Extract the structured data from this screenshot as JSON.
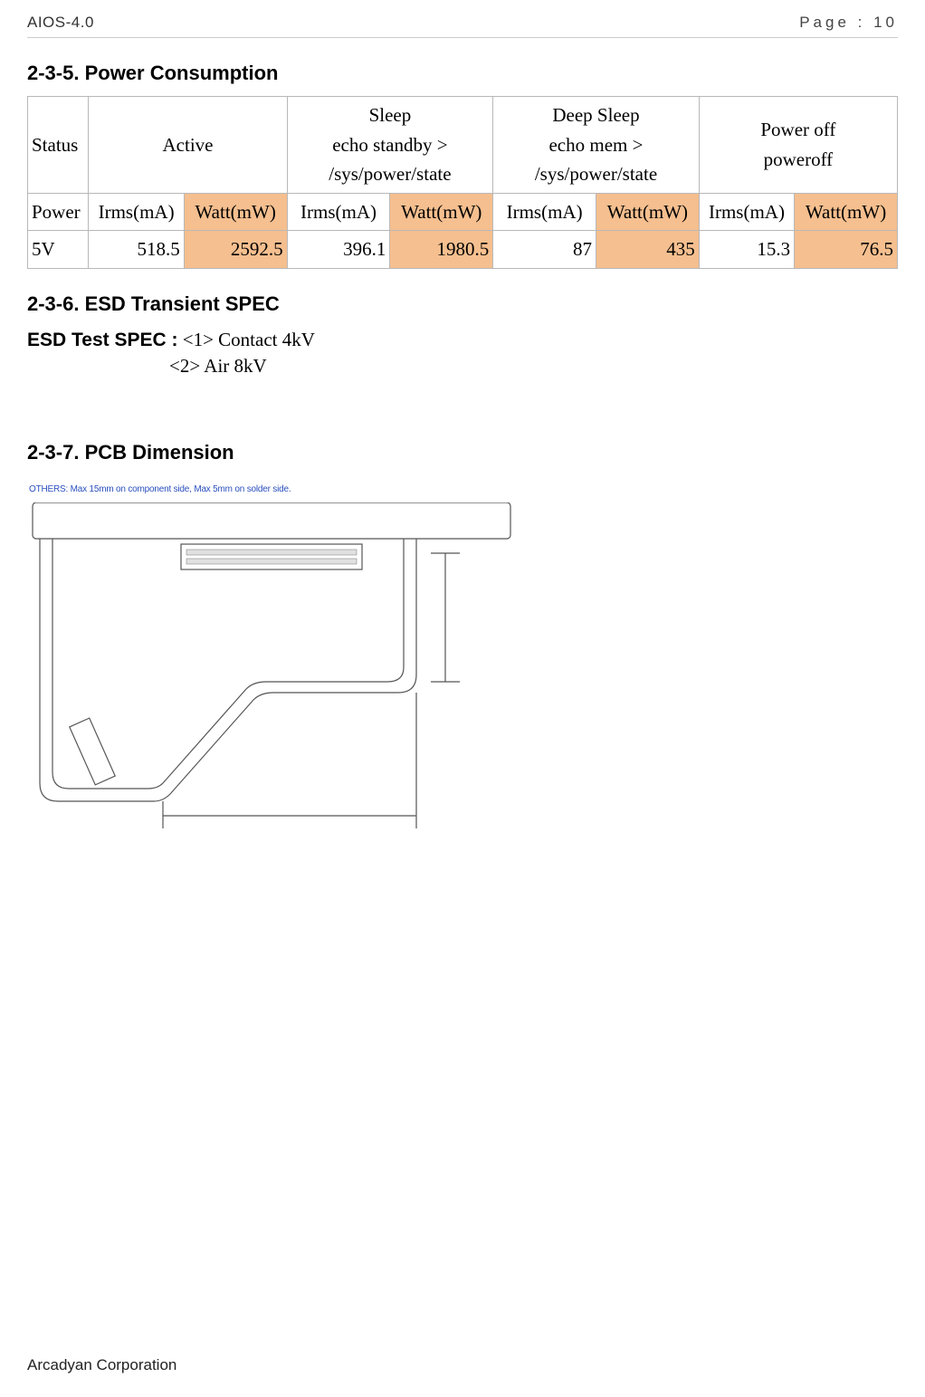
{
  "header": {
    "doc_id": "AIOS-4.0",
    "page": "Page : 10"
  },
  "sections": {
    "s235": {
      "title": "2-3-5. Power Consumption"
    },
    "s236": {
      "title": "2-3-6. ESD Transient SPEC"
    },
    "s237": {
      "title": "2-3-7. PCB Dimension"
    }
  },
  "chart_data": {
    "type": "table",
    "title": "Power Consumption",
    "row_labels": [
      "Status",
      "Power",
      "5V"
    ],
    "columns": [
      {
        "status": "Active",
        "metrics": [
          "Irms(mA)",
          "Watt(mW)"
        ]
      },
      {
        "status": "Sleep\necho standby >\n/sys/power/state",
        "metrics": [
          "Irms(mA)",
          "Watt(mW)"
        ]
      },
      {
        "status": "Deep Sleep\necho mem >\n/sys/power/state",
        "metrics": [
          "Irms(mA)",
          "Watt(mW)"
        ]
      },
      {
        "status": "Power off\npoweroff",
        "metrics": [
          "Irms(mA)",
          "Watt(mW)"
        ]
      }
    ],
    "values": {
      "5V": {
        "active": {
          "irms_ma": 518.5,
          "watt_mw": 2592.5
        },
        "sleep": {
          "irms_ma": 396.1,
          "watt_mw": 1980.5
        },
        "deep_sleep": {
          "irms_ma": 87,
          "watt_mw": 435
        },
        "power_off": {
          "irms_ma": 15.3,
          "watt_mw": 76.5
        }
      }
    }
  },
  "power_table": {
    "row_status": "Status",
    "row_power": "Power",
    "row_5v": "5V",
    "cols": {
      "active": {
        "status_l1": "Active",
        "status_l2": "",
        "status_l3": "",
        "irms": "Irms(mA)",
        "watt": "Watt(mW)",
        "v_irms": "518.5",
        "v_watt": "2592.5"
      },
      "sleep": {
        "status_l1": "Sleep",
        "status_l2": "echo standby >",
        "status_l3": "/sys/power/state",
        "irms": "Irms(mA)",
        "watt": "Watt(mW)",
        "v_irms": "396.1",
        "v_watt": "1980.5"
      },
      "deep": {
        "status_l1": "Deep Sleep",
        "status_l2": "echo mem >",
        "status_l3": "/sys/power/state",
        "irms": "Irms(mA)",
        "watt": "Watt(mW)",
        "v_irms": "87",
        "v_watt": "435"
      },
      "off": {
        "status_l1": "Power off",
        "status_l2": "poweroff",
        "status_l3": "",
        "irms": "Irms(mA)",
        "watt": "Watt(mW)",
        "v_irms": "15.3",
        "v_watt": "76.5"
      }
    }
  },
  "esd": {
    "label": "ESD Test SPEC :",
    "item1_tag": "<1>",
    "item1_val": "Contact 4kV",
    "item2_tag": "<2>",
    "item2_val": "Air 8kV"
  },
  "pcb": {
    "note": "OTHERS: Max 15mm on component side, Max 5mm on solder side."
  },
  "footer": {
    "company": "Arcadyan Corporation"
  }
}
